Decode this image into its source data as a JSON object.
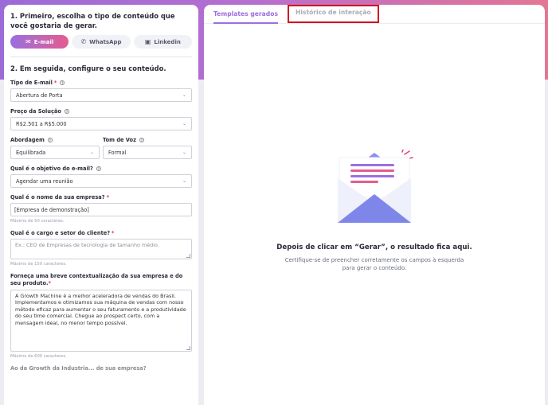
{
  "left": {
    "step1_title": "1. Primeiro, escolha o tipo de conteúdo que você gostaria de gerar.",
    "channels": [
      {
        "label": "E-mail",
        "icon": "mail-icon",
        "active": true
      },
      {
        "label": "WhatsApp",
        "icon": "whatsapp-icon",
        "active": false
      },
      {
        "label": "Linkedin",
        "icon": "linkedin-icon",
        "active": false
      }
    ],
    "step2_title": "2. Em seguida, configure o seu conteúdo.",
    "email_type": {
      "label": "Tipo de E-mail",
      "required": "*",
      "value": "Abertura de Porta"
    },
    "price": {
      "label": "Preço da Solução",
      "value": "R$2.501 a R$5.000"
    },
    "approach": {
      "label": "Abordagem",
      "value": "Equilibrada"
    },
    "tone": {
      "label": "Tom de Voz",
      "value": "Formal"
    },
    "objective": {
      "label": "Qual é o objetivo do e-mail?",
      "value": "Agendar uma reunião"
    },
    "company_name": {
      "label": "Qual é o nome da sua empresa?",
      "required": "*",
      "value": "[Empresa de demonstração]",
      "hint": "Máximo de 50 caracteres."
    },
    "client_role": {
      "label": "Qual é o cargo e setor do cliente?",
      "required": "*",
      "placeholder": "Ex.: CEO de Empresas de tecnologia de tamanho médio.",
      "hint": "Máximo de 150 caracteres."
    },
    "context": {
      "label": "Forneça uma breve contextualização da sua empresa e do seu produto.",
      "required": "*",
      "value": "A Growth Machine é a melhor aceleradora de vendas do Brasil. Implementamos e otimizamos sua máquina de vendas com nosso método eficaz para aumentar o seu faturamento e a produtividade do seu time comercial. Chegue ao prospect certo, com a mensagem ideal, no menor tempo possível.",
      "hint": "Máximo de 600 caracteres."
    },
    "cut_label": "Ao da Growth da Industria... de sua empresa?"
  },
  "right": {
    "tabs": [
      {
        "label": "Templates gerados",
        "active": true
      },
      {
        "label": "Histórico de interação",
        "active": false
      }
    ],
    "empty_title": "Depois de clicar em “Gerar”, o resultado fica aqui.",
    "empty_sub": "Certifique-se de preencher corretamente os campos à esquerda para gerar o conteúdo."
  },
  "colors": {
    "accent_purple": "#9d6ee0",
    "accent_pink": "#e45c8e",
    "highlight_red": "#d60f1c"
  }
}
